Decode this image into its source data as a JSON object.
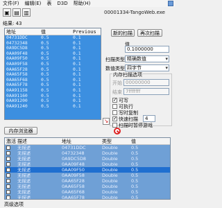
{
  "menu": {
    "items": [
      "文件(F)",
      "编辑(E)",
      "表",
      "D3D",
      "帮助(H)"
    ]
  },
  "window": {
    "process_title": "00001334-TangoWeb.exe"
  },
  "results": {
    "found_label": "结果: 43",
    "columns": [
      "地址",
      "值",
      "Previous"
    ],
    "rows": [
      {
        "address": "04731DDC",
        "value": "0.5",
        "previous": "0.1"
      },
      {
        "address": "04732348",
        "value": "0.5",
        "previous": "0.1"
      },
      {
        "address": "0A9DC5D8",
        "value": "0.5",
        "previous": "0.1"
      },
      {
        "address": "0AA09F48",
        "value": "0.5",
        "previous": "0.1"
      },
      {
        "address": "0AA09F50",
        "value": "0.5",
        "previous": "0.1"
      },
      {
        "address": "0AA09F58",
        "value": "0.5",
        "previous": "0.1"
      },
      {
        "address": "0AA65F28",
        "value": "0.5",
        "previous": "0.1"
      },
      {
        "address": "0AA65F58",
        "value": "0.5",
        "previous": "0.1"
      },
      {
        "address": "0AA65F68",
        "value": "0.5",
        "previous": "0.1"
      },
      {
        "address": "0AA65F78",
        "value": "0.5",
        "previous": "0.1"
      },
      {
        "address": "0AA91158",
        "value": "0.5",
        "previous": "0.1"
      },
      {
        "address": "0AA91160",
        "value": "0.5",
        "previous": "0.1"
      },
      {
        "address": "0AA91200",
        "value": "0.5",
        "previous": "0.1"
      },
      {
        "address": "0AA91240",
        "value": "0.5",
        "previous": "0.1"
      }
    ]
  },
  "scan": {
    "new_scan": "新的扫描",
    "next_scan": "再次扫描",
    "value_label": "值",
    "value_input": "0.1000000",
    "scan_type_label": "扫描类型",
    "scan_type_value": "精确数值",
    "value_type_label": "数值类型",
    "value_type_value": "四字节",
    "memory_options": "内存扫描选项",
    "start_label": "开始",
    "start_value": "00000000",
    "stop_label": "结束",
    "stop_value": "7fffffff",
    "writable_label": "可写",
    "executable_label": "可执行",
    "copy_on_write_label": "写时复制",
    "fast_scan_label": "快速扫描",
    "fast_scan_value": "4",
    "pause_label": "扫描时暂停游戏"
  },
  "memory_view_button": "内存浏览器",
  "address_list": {
    "columns": [
      "激活",
      "描述",
      "地址",
      "类型",
      "值"
    ],
    "rows": [
      {
        "desc": "无描述",
        "address": "04731DDC",
        "type": "Double",
        "value": "0.5",
        "selected": false
      },
      {
        "desc": "无描述",
        "address": "04732348",
        "type": "Double",
        "value": "0.5",
        "selected": false
      },
      {
        "desc": "无描述",
        "address": "0A9DC5D8",
        "type": "Double",
        "value": "0.5",
        "selected": false
      },
      {
        "desc": "无描述",
        "address": "0AA09F48",
        "type": "Double",
        "value": "0.5",
        "selected": false
      },
      {
        "desc": "无描述",
        "address": "0AA09F50",
        "type": "Double",
        "value": "0.5",
        "selected": true
      },
      {
        "desc": "无描述",
        "address": "0AA09F58",
        "type": "Double",
        "value": "0.5",
        "selected": false
      },
      {
        "desc": "无描述",
        "address": "0AA65F28",
        "type": "Double",
        "value": "0.5",
        "selected": false
      },
      {
        "desc": "无描述",
        "address": "0AA65F58",
        "type": "Double",
        "value": "0.5",
        "selected": false
      },
      {
        "desc": "无描述",
        "address": "0AA65F68",
        "type": "Double",
        "value": "0.5",
        "selected": false
      },
      {
        "desc": "无描述",
        "address": "0AA65F78",
        "type": "Double",
        "value": "0.5",
        "selected": false
      }
    ]
  },
  "footer": {
    "advanced_options": "高级选项"
  },
  "icons": {
    "open_process": "computer-icon",
    "open_file": "folder-icon",
    "save": "save-icon",
    "pointer_arrow": "arrow-icon",
    "clear": "no-icon"
  }
}
